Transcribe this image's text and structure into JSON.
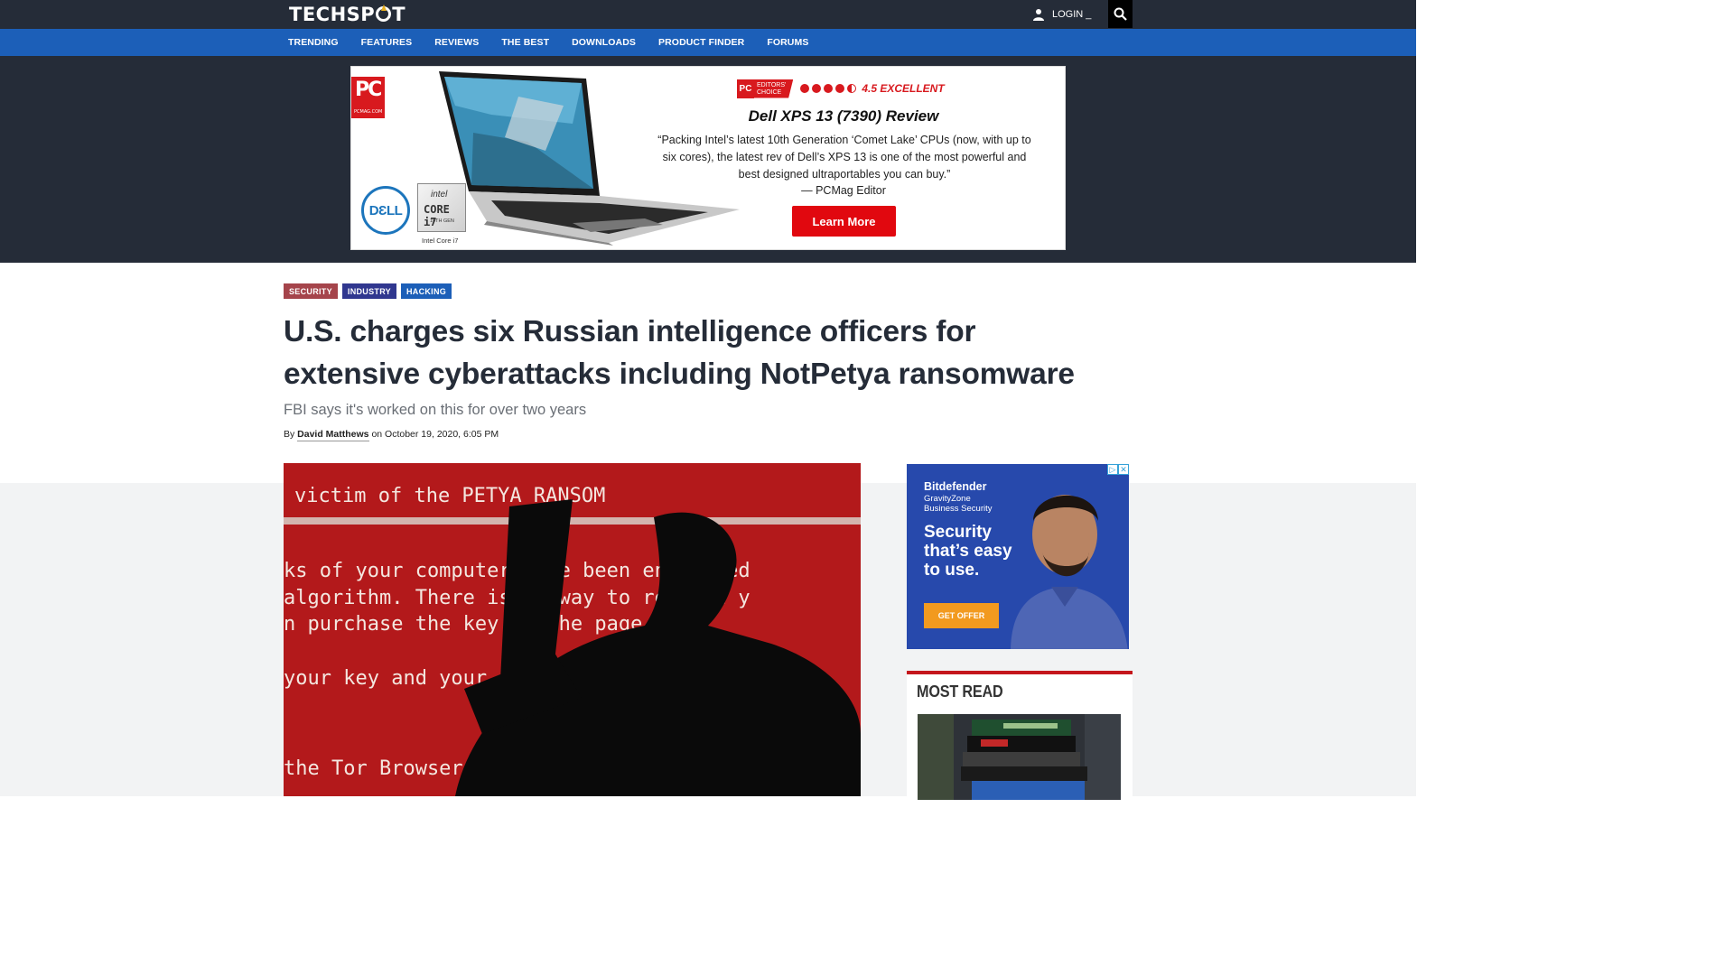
{
  "header": {
    "logo": "TECHSPOT",
    "login_label": "LOGIN _"
  },
  "nav": {
    "items": [
      "TRENDING",
      "FEATURES",
      "REVIEWS",
      "THE BEST",
      "DOWNLOADS",
      "PRODUCT FINDER",
      "FORUMS"
    ]
  },
  "top_ad": {
    "pcmag_logo": "PC",
    "pcmag_url": "PCMAG.COM",
    "editors_choice_1": "EDITORS'",
    "editors_choice_2": "CHOICE",
    "rating_text": "4.5 EXCELLENT",
    "rating_value": 4.5,
    "title": "Dell XPS 13 (7390) Review",
    "quote": "“Packing Intel’s latest 10th Generation ‘Comet Lake’ CPUs (now, with up to six cores), the latest rev of Dell’s XPS 13 is one of the most powerful and best designed ultraportables you can buy.”",
    "attribution": "— PCMag Editor",
    "button": "Learn More",
    "dell_logo": "DƐLL",
    "intel_brand": "intel",
    "intel_model": "CORE i7",
    "intel_gen": "10TH GEN",
    "intel_caption": "Intel Core i7"
  },
  "article": {
    "tags": [
      "SECURITY",
      "INDUSTRY",
      "HACKING"
    ],
    "headline": "U.S. charges six Russian intelligence officers for extensive cyberattacks including NotPetya ransomware",
    "subheadline": "FBI says it's worked on this for over two years",
    "byline_prefix": "By ",
    "author": "David Matthews",
    "byline_suffix": " on October 19, 2020, 6:05 PM"
  },
  "hero_image": {
    "lines": [
      "victim of the PETYA RANSOM",
      "ks of your computer have been encrypted",
      "algorithm.  There is no way to restore y",
      "n purchase the key on the page",
      "your key and your da",
      "the Tor Browser  \"http"
    ]
  },
  "side_ad": {
    "brand": "Bitdefender",
    "line1": "GravityZone",
    "line2": "Business Security",
    "tagline": "Security that’s easy to use.",
    "button": "GET OFFER"
  },
  "sidebar": {
    "most_read_title": "MOST READ"
  },
  "colors": {
    "topbar": "#252c38",
    "nav": "#1c5fb8",
    "accent_red": "#c4161c"
  }
}
